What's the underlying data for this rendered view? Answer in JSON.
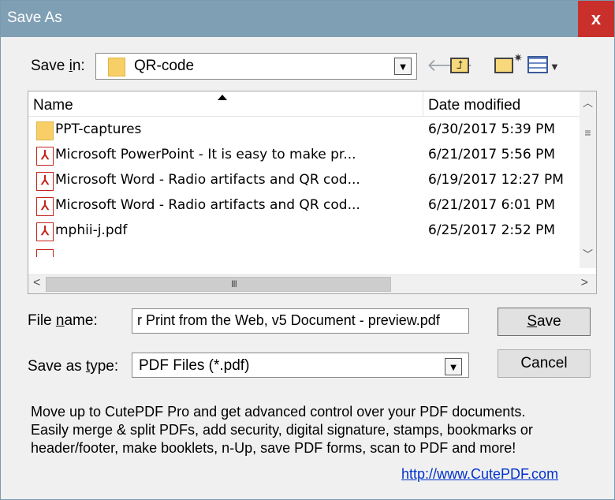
{
  "window": {
    "title": "Save As",
    "close_label": "x"
  },
  "save_in": {
    "label": "Save in:",
    "label_accel": "i",
    "folder": "QR-code"
  },
  "toolbar": {
    "back": "back-arrow-icon",
    "up": "up-folder-icon",
    "new_folder": "new-folder-icon",
    "views": "views-menu-icon"
  },
  "file_list": {
    "columns": {
      "name": "Name",
      "date": "Date modified"
    },
    "rows": [
      {
        "icon": "folder-icon",
        "name": "PPT-captures",
        "date": "6/30/2017 5:39 PM"
      },
      {
        "icon": "pdf-icon",
        "name": "Microsoft PowerPoint - It is easy to make pr...",
        "date": "6/21/2017 5:56 PM"
      },
      {
        "icon": "pdf-icon",
        "name": "Microsoft Word - Radio artifacts and QR cod...",
        "date": "6/19/2017 12:27 PM"
      },
      {
        "icon": "pdf-icon",
        "name": "Microsoft Word - Radio artifacts and QR cod...",
        "date": "6/21/2017 6:01 PM"
      },
      {
        "icon": "pdf-icon",
        "name": "mphii-j.pdf",
        "date": "6/25/2017 2:52 PM"
      }
    ],
    "hscroll_grip": "III"
  },
  "file_name": {
    "label": "File name:",
    "value": "r Print from the Web, v5 Document - preview.pdf"
  },
  "save_type": {
    "label": "Save as type:",
    "value": "PDF Files (*.pdf)"
  },
  "buttons": {
    "save": "Save",
    "cancel": "Cancel"
  },
  "promo": {
    "line1": "Move up to CutePDF Pro and get advanced control over your PDF documents.",
    "line2": "Easily merge & split PDFs, add security, digital signature, stamps, bookmarks or",
    "line3": "header/footer, make booklets, n-Up, save PDF forms, scan to PDF and more!",
    "link": "http://www.CutePDF.com"
  },
  "colors": {
    "titlebar": "#7f9fb4",
    "close": "#c9302c",
    "link": "#0033cc",
    "pdf_icon": "#c5241b",
    "folder": "#f7cf66"
  }
}
